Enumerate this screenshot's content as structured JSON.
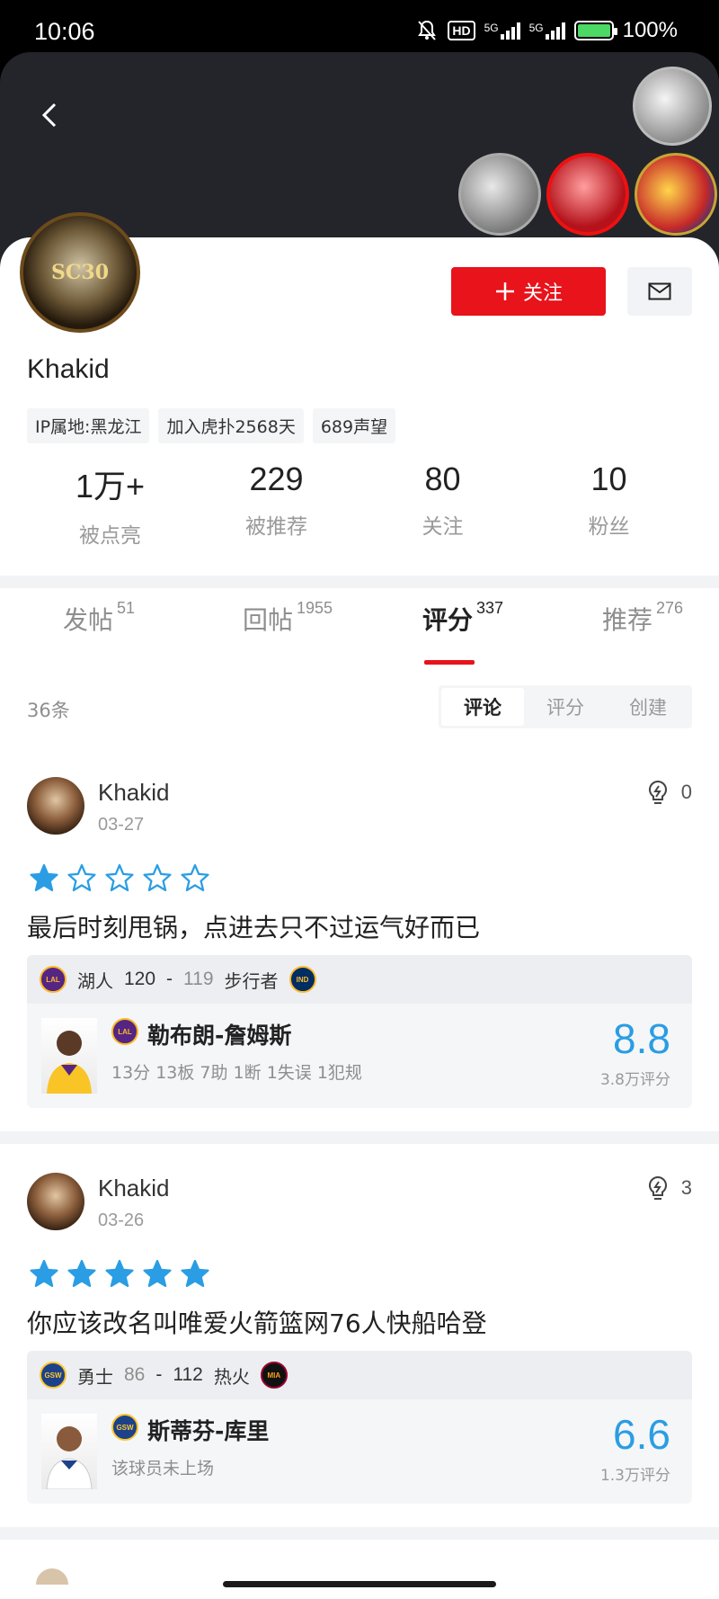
{
  "status_bar": {
    "time": "10:06",
    "hd_label": "HD",
    "network_1": "5G",
    "network_2": "5G",
    "battery": "100%"
  },
  "profile": {
    "avatar_text": "SC30",
    "follow_label": "关注",
    "username": "Khakid",
    "tags": [
      "IP属地:黑龙江",
      "加入虎扑2568天",
      "689声望"
    ],
    "stats": [
      {
        "value": "1万+",
        "label": "被点亮"
      },
      {
        "value": "229",
        "label": "被推荐"
      },
      {
        "value": "80",
        "label": "关注"
      },
      {
        "value": "10",
        "label": "粉丝"
      }
    ]
  },
  "tabs": [
    {
      "label": "发帖",
      "count": "51"
    },
    {
      "label": "回帖",
      "count": "1955"
    },
    {
      "label": "评分",
      "count": "337"
    },
    {
      "label": "推荐",
      "count": "276"
    }
  ],
  "list": {
    "count": "36条",
    "filters": [
      "评论",
      "评分",
      "创建"
    ]
  },
  "reviews": [
    {
      "name": "Khakid",
      "date": "03-27",
      "likes": "0",
      "stars": 1,
      "text": "最后时刻甩锅，点进去只不过运气好而已",
      "home_team": "湖人",
      "home_score": "120",
      "dash": "-",
      "away_score": "119",
      "away_team": "步行者",
      "home_logo": "LAL",
      "away_logo": "IND",
      "player": "勒布朗-詹姆斯",
      "player_logo": "LAL",
      "player_stat": "13分 13板 7助 1断 1失误 1犯规",
      "rating": "8.8",
      "rating_count": "3.8万评分"
    },
    {
      "name": "Khakid",
      "date": "03-26",
      "likes": "3",
      "stars": 5,
      "text": "你应该改名叫唯爱火箭篮网76人快船哈登",
      "home_team": "勇士",
      "home_score": "86",
      "dash": "-",
      "away_score": "112",
      "away_team": "热火",
      "home_logo": "GSW",
      "away_logo": "MIA",
      "player": "斯蒂芬-库里",
      "player_logo": "GSW",
      "player_stat": "该球员未上场",
      "rating": "6.6",
      "rating_count": "1.3万评分"
    }
  ],
  "colors": {
    "accent_red": "#e8131b",
    "star_blue": "#2a9de4",
    "rating_blue": "#2a9de4"
  }
}
